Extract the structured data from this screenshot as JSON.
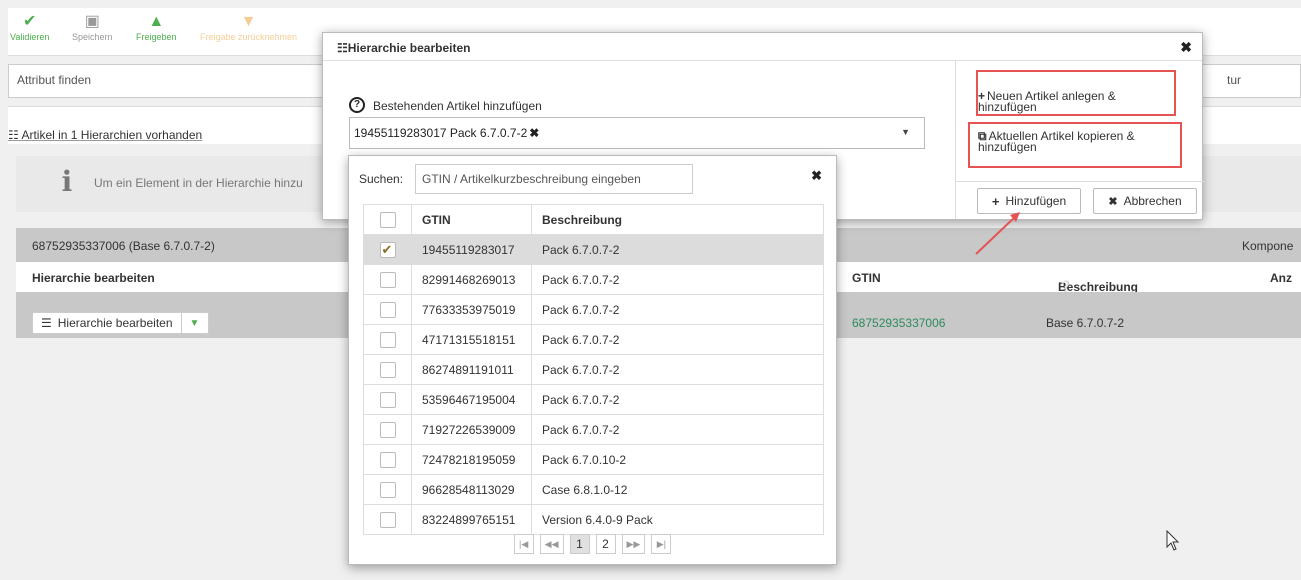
{
  "toolbar": {
    "validate": "Validieren",
    "save": "Speichern",
    "approve": "Freigeben",
    "revoke": "Freigabe zurücknehmen"
  },
  "find_attribute": {
    "placeholder": "Attribut finden",
    "right_fragment": "tur"
  },
  "section": {
    "title": "Artikel in 1 Hierarchien vorhanden"
  },
  "info": {
    "text": "Um ein Element in der Hierarchie hinzu"
  },
  "base_row": {
    "label": "68752935337006 (Base 6.7.0.7-2)",
    "right_label": "Kompone"
  },
  "table_head": {
    "hierarchy": "Hierarchie bearbeiten",
    "gtin": "GTIN",
    "description": "Beschreibung",
    "count": "Anz"
  },
  "data_row": {
    "edit_button": "Hierarchie bearbeiten",
    "gtin": "68752935337006",
    "description": "Base 6.7.0.7-2"
  },
  "modal": {
    "title": "Hierarchie bearbeiten",
    "existing_label": "Bestehenden Artikel hinzufügen",
    "selected_tag": "19455119283017 Pack 6.7.0.7-2",
    "new_article_line1": "Neuen Artikel anlegen &",
    "new_article_line2": "hinzufügen",
    "copy_article_line1": "Aktuellen Artikel kopieren &",
    "copy_article_line2": "hinzufügen",
    "add_button": "Hinzufügen",
    "cancel_button": "Abbrechen"
  },
  "dropdown": {
    "search_label": "Suchen:",
    "search_placeholder": "GTIN / Artikelkurzbeschreibung eingeben",
    "col_gtin": "GTIN",
    "col_desc": "Beschreibung",
    "rows": [
      {
        "gtin": "19455119283017",
        "desc": "Pack 6.7.0.7-2",
        "checked": true
      },
      {
        "gtin": "82991468269013",
        "desc": "Pack 6.7.0.7-2",
        "checked": false
      },
      {
        "gtin": "77633353975019",
        "desc": "Pack 6.7.0.7-2",
        "checked": false
      },
      {
        "gtin": "47171315518151",
        "desc": "Pack 6.7.0.7-2",
        "checked": false
      },
      {
        "gtin": "86274891191011",
        "desc": "Pack 6.7.0.7-2",
        "checked": false
      },
      {
        "gtin": "53596467195004",
        "desc": "Pack 6.7.0.7-2",
        "checked": false
      },
      {
        "gtin": "71927226539009",
        "desc": "Pack 6.7.0.7-2",
        "checked": false
      },
      {
        "gtin": "72478218195059",
        "desc": "Pack 6.7.0.10-2",
        "checked": false
      },
      {
        "gtin": "96628548113029",
        "desc": "Case 6.8.1.0-12",
        "checked": false
      },
      {
        "gtin": "83224899765151",
        "desc": "Version 6.4.0-9 Pack",
        "checked": false
      }
    ],
    "pages": [
      "1",
      "2"
    ],
    "current_page": "1"
  },
  "colors": {
    "accent_green": "#4cae4c",
    "gtin_link": "#2d8a5e",
    "annotation_red": "#e55353",
    "disabled_orange": "#f0ad4e"
  }
}
